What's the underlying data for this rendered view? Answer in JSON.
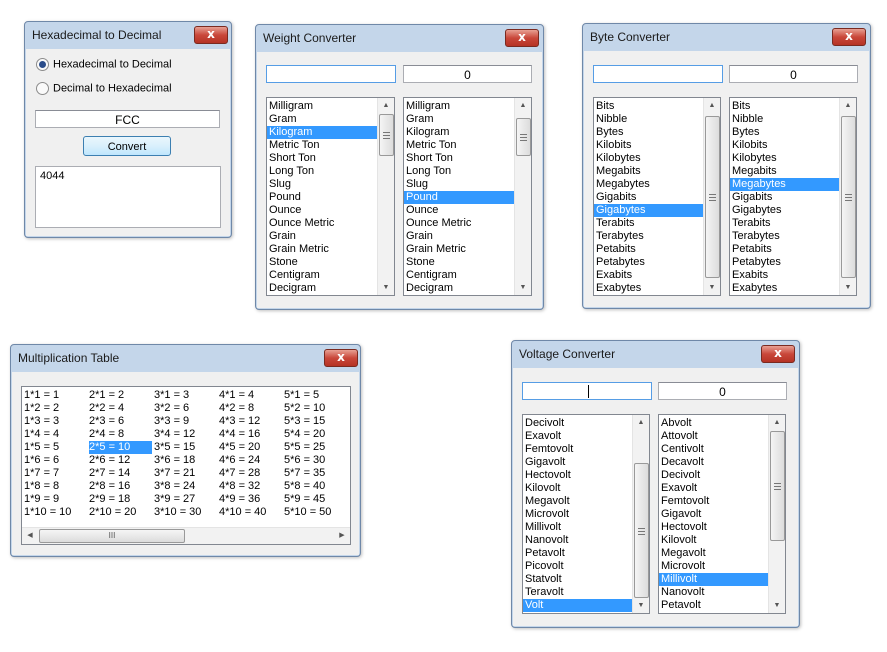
{
  "hex_window": {
    "title": "Hexadecimal to Decimal",
    "radio_hex_to_dec": "Hexadecimal to Decimal",
    "radio_dec_to_hex": "Decimal to Hexadecimal",
    "selected_radio": "hex_to_dec",
    "input_value": "FCC",
    "convert_label": "Convert",
    "output_value": "4044",
    "close_glyph": "x"
  },
  "weight_window": {
    "title": "Weight Converter",
    "input_value": "",
    "output_value": "0",
    "close_glyph": "x",
    "from_units": [
      "Milligram",
      "Gram",
      "Kilogram",
      "Metric Ton",
      "Short Ton",
      "Long Ton",
      "Slug",
      "Pound",
      "Ounce",
      "Ounce Metric",
      "Grain",
      "Grain Metric",
      "Stone",
      "Centigram",
      "Decigram"
    ],
    "from_selected": "Kilogram",
    "to_units": [
      "Milligram",
      "Gram",
      "Kilogram",
      "Metric Ton",
      "Short Ton",
      "Long Ton",
      "Slug",
      "Pound",
      "Ounce",
      "Ounce Metric",
      "Grain",
      "Grain Metric",
      "Stone",
      "Centigram",
      "Decigram"
    ],
    "to_selected": "Pound"
  },
  "byte_window": {
    "title": "Byte Converter",
    "input_value": "",
    "output_value": "0",
    "close_glyph": "x",
    "from_units": [
      "Bits",
      "Nibble",
      "Bytes",
      "Kilobits",
      "Kilobytes",
      "Megabits",
      "Megabytes",
      "Gigabits",
      "Gigabytes",
      "Terabits",
      "Terabytes",
      "Petabits",
      "Petabytes",
      "Exabits",
      "Exabytes"
    ],
    "from_selected": "Gigabytes",
    "to_units": [
      "Bits",
      "Nibble",
      "Bytes",
      "Kilobits",
      "Kilobytes",
      "Megabits",
      "Megabytes",
      "Gigabits",
      "Gigabytes",
      "Terabits",
      "Terabytes",
      "Petabits",
      "Petabytes",
      "Exabits",
      "Exabytes"
    ],
    "to_selected": "Megabytes"
  },
  "mult_window": {
    "title": "Multiplication Table",
    "close_glyph": "x",
    "scroll_grip": "III",
    "columns": [
      [
        "1*1 = 1",
        "1*2 = 2",
        "1*3 = 3",
        "1*4 = 4",
        "1*5 = 5",
        "1*6 = 6",
        "1*7 = 7",
        "1*8 = 8",
        "1*9 = 9",
        "1*10 = 10"
      ],
      [
        "2*1 = 2",
        "2*2 = 4",
        "2*3 = 6",
        "2*4 = 8",
        "2*5 = 10",
        "2*6 = 12",
        "2*7 = 14",
        "2*8 = 16",
        "2*9 = 18",
        "2*10 = 20"
      ],
      [
        "3*1 = 3",
        "3*2 = 6",
        "3*3 = 9",
        "3*4 = 12",
        "3*5 = 15",
        "3*6 = 18",
        "3*7 = 21",
        "3*8 = 24",
        "3*9 = 27",
        "3*10 = 30"
      ],
      [
        "4*1 = 4",
        "4*2 = 8",
        "4*3 = 12",
        "4*4 = 16",
        "4*5 = 20",
        "4*6 = 24",
        "4*7 = 28",
        "4*8 = 32",
        "4*9 = 36",
        "4*10 = 40"
      ],
      [
        "5*1 = 5",
        "5*2 = 10",
        "5*3 = 15",
        "5*4 = 20",
        "5*5 = 25",
        "5*6 = 30",
        "5*7 = 35",
        "5*8 = 40",
        "5*9 = 45",
        "5*10 = 50"
      ]
    ],
    "selected": "2*5 = 10"
  },
  "voltage_window": {
    "title": "Voltage Converter",
    "input_value": "",
    "output_value": "0",
    "close_glyph": "x",
    "from_units": [
      "Decivolt",
      "Exavolt",
      "Femtovolt",
      "Gigavolt",
      "Hectovolt",
      "Kilovolt",
      "Megavolt",
      "Microvolt",
      "Millivolt",
      "Nanovolt",
      "Petavolt",
      "Picovolt",
      "Statvolt",
      "Teravolt",
      "Volt"
    ],
    "from_selected": "Volt",
    "to_units": [
      "Abvolt",
      "Attovolt",
      "Centivolt",
      "Decavolt",
      "Decivolt",
      "Exavolt",
      "Femtovolt",
      "Gigavolt",
      "Hectovolt",
      "Kilovolt",
      "Megavolt",
      "Microvolt",
      "Millivolt",
      "Nanovolt",
      "Petavolt"
    ],
    "to_selected": "Millivolt"
  }
}
